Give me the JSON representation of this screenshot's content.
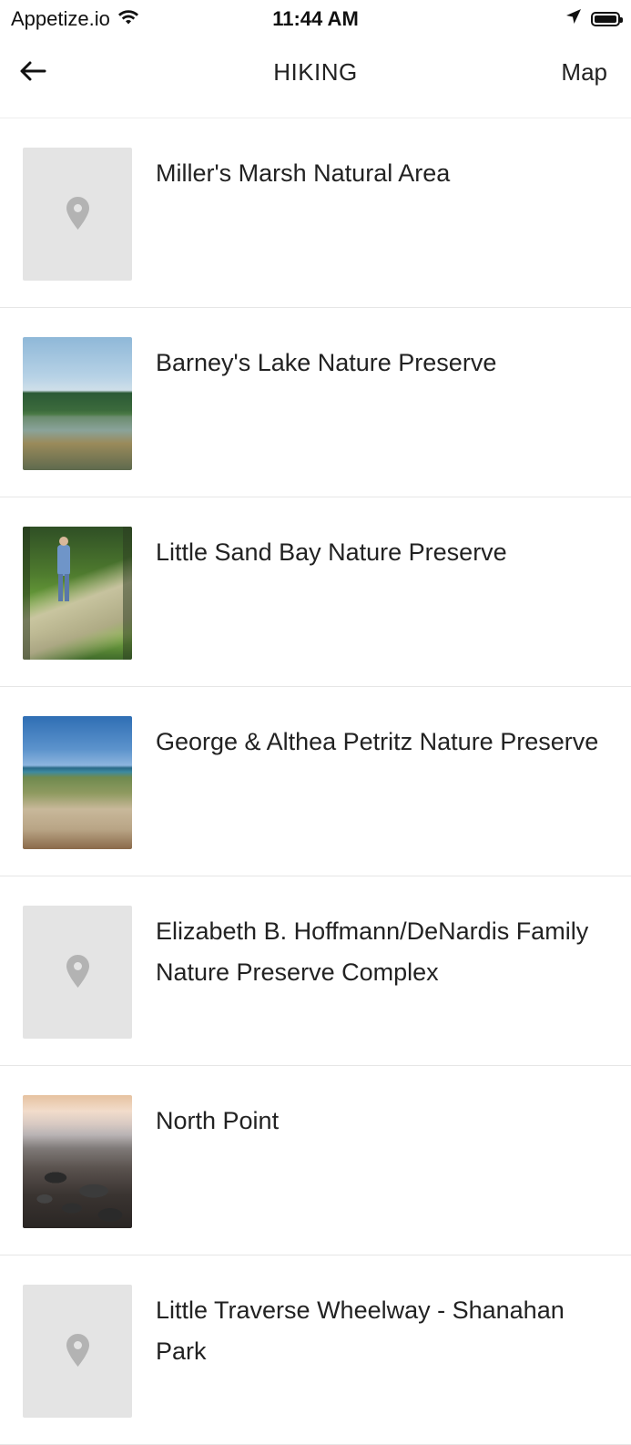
{
  "status_bar": {
    "carrier": "Appetize.io",
    "time": "11:44 AM",
    "wifi_icon": "wifi-icon",
    "location_icon": "location-arrow-icon",
    "battery_icon": "battery-full-icon"
  },
  "nav": {
    "back_icon": "arrow-left-icon",
    "title": "HIKING",
    "map_label": "Map"
  },
  "list": {
    "items": [
      {
        "title": "Miller's Marsh Natural Area",
        "image": "placeholder"
      },
      {
        "title": "Barney's Lake Nature Preserve",
        "image": "lake-photo"
      },
      {
        "title": "Little Sand Bay Nature Preserve",
        "image": "forest-boardwalk-photo"
      },
      {
        "title": "George & Althea Petritz Nature Preserve",
        "image": "beach-dune-photo"
      },
      {
        "title": "Elizabeth B. Hoffmann/DeNardis Family Nature Preserve Complex",
        "image": "placeholder"
      },
      {
        "title": "North Point",
        "image": "rocky-shore-sunset-photo"
      },
      {
        "title": "Little Traverse Wheelway - Shanahan Park",
        "image": "placeholder"
      }
    ]
  },
  "colors": {
    "background": "#ffffff",
    "text": "#222222",
    "divider": "#e6e6e6",
    "placeholder_bg": "#e4e4e4",
    "placeholder_icon": "#b3b3b3"
  }
}
